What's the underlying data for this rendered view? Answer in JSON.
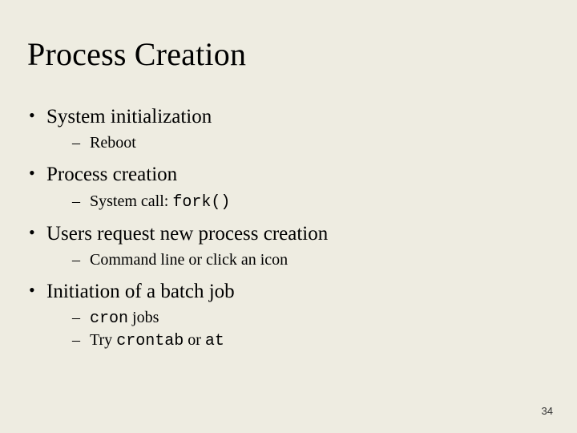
{
  "title": "Process Creation",
  "bullets": [
    {
      "text": "System initialization",
      "sub": [
        {
          "text": "Reboot"
        }
      ]
    },
    {
      "text": "Process creation",
      "sub": [
        {
          "prefix": "System call: ",
          "code": "fork()"
        }
      ]
    },
    {
      "text": "Users request new process creation",
      "sub": [
        {
          "text": "Command line or click an icon"
        }
      ]
    },
    {
      "text": "Initiation of a batch job",
      "sub": [
        {
          "code": "cron",
          "suffix": " jobs"
        },
        {
          "prefix": "Try ",
          "code": "crontab",
          "mid": " or ",
          "code2": "at"
        }
      ]
    }
  ],
  "pageNumber": "34"
}
